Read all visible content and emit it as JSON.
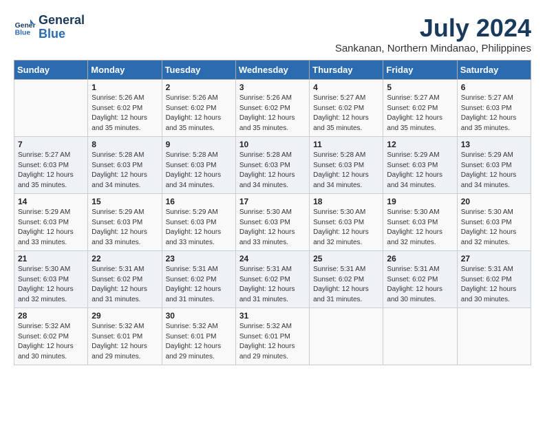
{
  "header": {
    "logo_line1": "General",
    "logo_line2": "Blue",
    "month_year": "July 2024",
    "location": "Sankanan, Northern Mindanao, Philippines"
  },
  "weekdays": [
    "Sunday",
    "Monday",
    "Tuesday",
    "Wednesday",
    "Thursday",
    "Friday",
    "Saturday"
  ],
  "weeks": [
    [
      {
        "day": "",
        "info": ""
      },
      {
        "day": "1",
        "info": "Sunrise: 5:26 AM\nSunset: 6:02 PM\nDaylight: 12 hours\nand 35 minutes."
      },
      {
        "day": "2",
        "info": "Sunrise: 5:26 AM\nSunset: 6:02 PM\nDaylight: 12 hours\nand 35 minutes."
      },
      {
        "day": "3",
        "info": "Sunrise: 5:26 AM\nSunset: 6:02 PM\nDaylight: 12 hours\nand 35 minutes."
      },
      {
        "day": "4",
        "info": "Sunrise: 5:27 AM\nSunset: 6:02 PM\nDaylight: 12 hours\nand 35 minutes."
      },
      {
        "day": "5",
        "info": "Sunrise: 5:27 AM\nSunset: 6:02 PM\nDaylight: 12 hours\nand 35 minutes."
      },
      {
        "day": "6",
        "info": "Sunrise: 5:27 AM\nSunset: 6:03 PM\nDaylight: 12 hours\nand 35 minutes."
      }
    ],
    [
      {
        "day": "7",
        "info": "Sunrise: 5:27 AM\nSunset: 6:03 PM\nDaylight: 12 hours\nand 35 minutes."
      },
      {
        "day": "8",
        "info": "Sunrise: 5:28 AM\nSunset: 6:03 PM\nDaylight: 12 hours\nand 34 minutes."
      },
      {
        "day": "9",
        "info": "Sunrise: 5:28 AM\nSunset: 6:03 PM\nDaylight: 12 hours\nand 34 minutes."
      },
      {
        "day": "10",
        "info": "Sunrise: 5:28 AM\nSunset: 6:03 PM\nDaylight: 12 hours\nand 34 minutes."
      },
      {
        "day": "11",
        "info": "Sunrise: 5:28 AM\nSunset: 6:03 PM\nDaylight: 12 hours\nand 34 minutes."
      },
      {
        "day": "12",
        "info": "Sunrise: 5:29 AM\nSunset: 6:03 PM\nDaylight: 12 hours\nand 34 minutes."
      },
      {
        "day": "13",
        "info": "Sunrise: 5:29 AM\nSunset: 6:03 PM\nDaylight: 12 hours\nand 34 minutes."
      }
    ],
    [
      {
        "day": "14",
        "info": "Sunrise: 5:29 AM\nSunset: 6:03 PM\nDaylight: 12 hours\nand 33 minutes."
      },
      {
        "day": "15",
        "info": "Sunrise: 5:29 AM\nSunset: 6:03 PM\nDaylight: 12 hours\nand 33 minutes."
      },
      {
        "day": "16",
        "info": "Sunrise: 5:29 AM\nSunset: 6:03 PM\nDaylight: 12 hours\nand 33 minutes."
      },
      {
        "day": "17",
        "info": "Sunrise: 5:30 AM\nSunset: 6:03 PM\nDaylight: 12 hours\nand 33 minutes."
      },
      {
        "day": "18",
        "info": "Sunrise: 5:30 AM\nSunset: 6:03 PM\nDaylight: 12 hours\nand 32 minutes."
      },
      {
        "day": "19",
        "info": "Sunrise: 5:30 AM\nSunset: 6:03 PM\nDaylight: 12 hours\nand 32 minutes."
      },
      {
        "day": "20",
        "info": "Sunrise: 5:30 AM\nSunset: 6:03 PM\nDaylight: 12 hours\nand 32 minutes."
      }
    ],
    [
      {
        "day": "21",
        "info": "Sunrise: 5:30 AM\nSunset: 6:03 PM\nDaylight: 12 hours\nand 32 minutes."
      },
      {
        "day": "22",
        "info": "Sunrise: 5:31 AM\nSunset: 6:02 PM\nDaylight: 12 hours\nand 31 minutes."
      },
      {
        "day": "23",
        "info": "Sunrise: 5:31 AM\nSunset: 6:02 PM\nDaylight: 12 hours\nand 31 minutes."
      },
      {
        "day": "24",
        "info": "Sunrise: 5:31 AM\nSunset: 6:02 PM\nDaylight: 12 hours\nand 31 minutes."
      },
      {
        "day": "25",
        "info": "Sunrise: 5:31 AM\nSunset: 6:02 PM\nDaylight: 12 hours\nand 31 minutes."
      },
      {
        "day": "26",
        "info": "Sunrise: 5:31 AM\nSunset: 6:02 PM\nDaylight: 12 hours\nand 30 minutes."
      },
      {
        "day": "27",
        "info": "Sunrise: 5:31 AM\nSunset: 6:02 PM\nDaylight: 12 hours\nand 30 minutes."
      }
    ],
    [
      {
        "day": "28",
        "info": "Sunrise: 5:32 AM\nSunset: 6:02 PM\nDaylight: 12 hours\nand 30 minutes."
      },
      {
        "day": "29",
        "info": "Sunrise: 5:32 AM\nSunset: 6:01 PM\nDaylight: 12 hours\nand 29 minutes."
      },
      {
        "day": "30",
        "info": "Sunrise: 5:32 AM\nSunset: 6:01 PM\nDaylight: 12 hours\nand 29 minutes."
      },
      {
        "day": "31",
        "info": "Sunrise: 5:32 AM\nSunset: 6:01 PM\nDaylight: 12 hours\nand 29 minutes."
      },
      {
        "day": "",
        "info": ""
      },
      {
        "day": "",
        "info": ""
      },
      {
        "day": "",
        "info": ""
      }
    ]
  ]
}
